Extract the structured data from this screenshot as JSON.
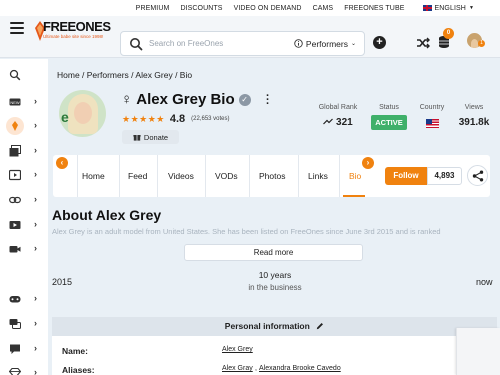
{
  "topbar": {
    "links": [
      "PREMIUM",
      "DISCOUNTS",
      "VIDEO ON DEMAND",
      "CAMS",
      "FREEONES TUBE"
    ],
    "language": "ENGLISH"
  },
  "header": {
    "logo_text": "FREEONES",
    "logo_tagline": "Ultimate babe site since 1998!",
    "search_placeholder": "Search on FreeOnes",
    "search_category": "Performers",
    "coin_badge": "0",
    "avatar_badge": "1"
  },
  "sidebar": {
    "icons": [
      "search-icon",
      "new-icon",
      "freeones-icon",
      "photos-icon",
      "videos-icon",
      "links-icon",
      "vod-icon",
      "cams-icon",
      "games-icon",
      "forum-icon",
      "chat-icon",
      "premium-icon"
    ]
  },
  "breadcrumb": "Home / Performers / Alex Grey / Bio",
  "profile": {
    "title": "Alex Grey Bio",
    "rating": "4.8",
    "votes": "(22,653 votes)",
    "donate_label": "Donate"
  },
  "stats": {
    "rank_label": "Global Rank",
    "rank_value": "321",
    "status_label": "Status",
    "status_value": "ACTIVE",
    "country_label": "Country",
    "views_label": "Views",
    "views_value": "391.8k"
  },
  "tabs": [
    "Home",
    "Feed",
    "Videos",
    "VODs",
    "Photos",
    "Links",
    "Bio"
  ],
  "follow": {
    "label": "Follow",
    "count": "4,893"
  },
  "about": {
    "heading": "About Alex Grey",
    "text": "Alex Grey is an adult model from United States. She has been listed on FreeOnes since June 3rd 2015 and is ranked",
    "read_more": "Read more"
  },
  "timeline": {
    "start": "2015",
    "end": "now",
    "duration": "10 years",
    "caption": "in the business"
  },
  "personal_info": {
    "heading": "Personal information",
    "name_label": "Name:",
    "name_value": "Alex Grey",
    "aliases_label": "Aliases:",
    "alias_1": "Alex Gray",
    "alias_2": "Alexandra Brooke Cavedo"
  },
  "colors": {
    "accent": "#f0820f",
    "status_green": "#3fb06a"
  }
}
